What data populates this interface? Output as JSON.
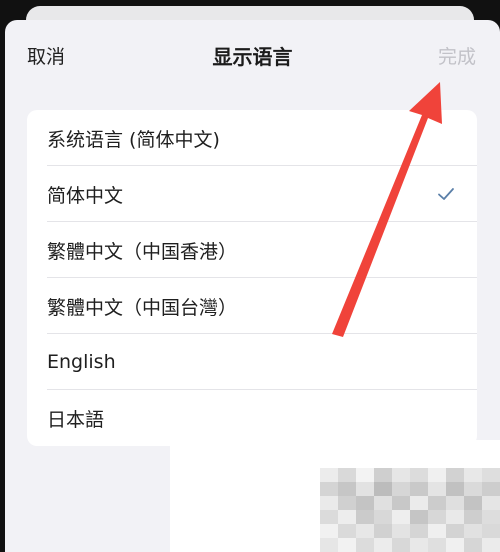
{
  "nav": {
    "cancel_label": "取消",
    "title": "显示语言",
    "done_label": "完成"
  },
  "languages": [
    {
      "label": "系统语言 (简体中文)",
      "selected": false
    },
    {
      "label": "简体中文",
      "selected": true
    },
    {
      "label": "繁體中文（中国香港）",
      "selected": false
    },
    {
      "label": "繁體中文（中国台灣）",
      "selected": false
    },
    {
      "label": "English",
      "selected": false
    },
    {
      "label": "日本語",
      "selected": false
    }
  ],
  "colors": {
    "accent_check": "#5a7fa8",
    "annotation_arrow": "#f0433a",
    "done_disabled": "#c2c2c8"
  },
  "icons": {
    "check": "checkmark-icon",
    "annotation": "red-arrow-annotation"
  }
}
